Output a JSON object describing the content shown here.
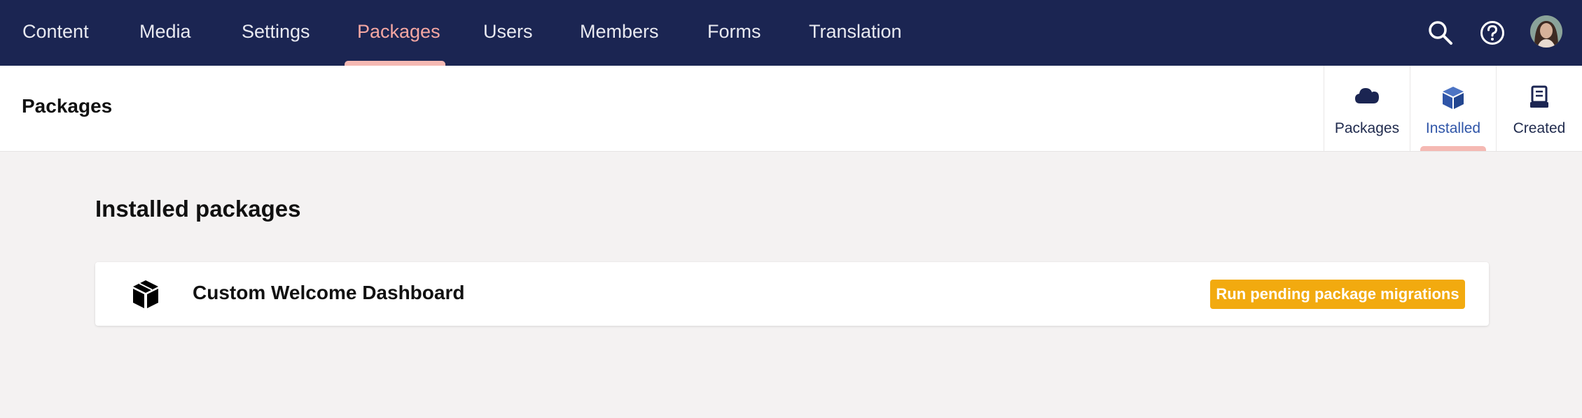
{
  "topnav": {
    "items": [
      {
        "label": "Content"
      },
      {
        "label": "Media"
      },
      {
        "label": "Settings"
      },
      {
        "label": "Packages",
        "active": true
      },
      {
        "label": "Users"
      },
      {
        "label": "Members"
      },
      {
        "label": "Forms"
      },
      {
        "label": "Translation"
      }
    ],
    "tools": [
      "search-icon",
      "help-icon",
      "avatar"
    ]
  },
  "header": {
    "title": "Packages",
    "tabs": [
      {
        "label": "Packages",
        "icon": "cloud-icon"
      },
      {
        "label": "Installed",
        "icon": "box-icon",
        "active": true
      },
      {
        "label": "Created",
        "icon": "archive-icon"
      }
    ]
  },
  "main": {
    "title": "Installed packages",
    "packages": [
      {
        "name": "Custom Welcome Dashboard",
        "icon": "package-icon",
        "action_label": "Run pending package migrations"
      }
    ]
  },
  "colors": {
    "topbar": "#1b2552",
    "active_nav": "#f5a7a2",
    "accent_underline": "#f5b9b3",
    "active_tab": "#2f55a8",
    "warning_button": "#f2aa0f"
  }
}
